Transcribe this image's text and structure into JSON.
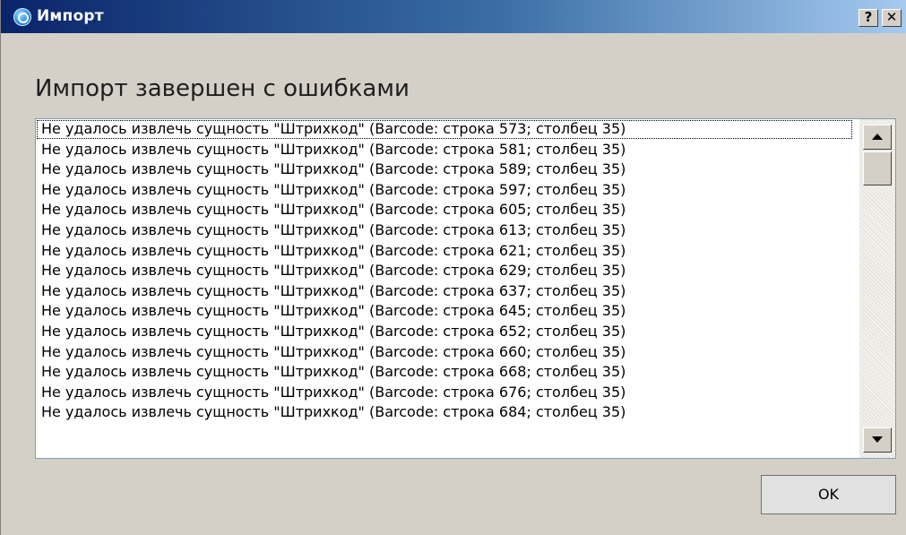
{
  "window": {
    "title": "Импорт",
    "help_label": "?",
    "close_label": "✕"
  },
  "heading": "Импорт завершен с ошибками",
  "errors": [
    "Не удалось извлечь сущность \"Штрихкод\" (Barcode: строка 573; столбец 35)",
    "Не удалось извлечь сущность \"Штрихкод\" (Barcode: строка 581; столбец 35)",
    "Не удалось извлечь сущность \"Штрихкод\" (Barcode: строка 589; столбец 35)",
    "Не удалось извлечь сущность \"Штрихкод\" (Barcode: строка 597; столбец 35)",
    "Не удалось извлечь сущность \"Штрихкод\" (Barcode: строка 605; столбец 35)",
    "Не удалось извлечь сущность \"Штрихкод\" (Barcode: строка 613; столбец 35)",
    "Не удалось извлечь сущность \"Штрихкод\" (Barcode: строка 621; столбец 35)",
    "Не удалось извлечь сущность \"Штрихкод\" (Barcode: строка 629; столбец 35)",
    "Не удалось извлечь сущность \"Штрихкод\" (Barcode: строка 637; столбец 35)",
    "Не удалось извлечь сущность \"Штрихкод\" (Barcode: строка 645; столбец 35)",
    "Не удалось извлечь сущность \"Штрихкод\" (Barcode: строка 652; столбец 35)",
    "Не удалось извлечь сущность \"Штрихкод\" (Barcode: строка 660; столбец 35)",
    "Не удалось извлечь сущность \"Штрихкод\" (Barcode: строка 668; столбец 35)",
    "Не удалось извлечь сущность \"Штрихкод\" (Barcode: строка 676; столбец 35)",
    "Не удалось извлечь сущность \"Штрихкод\" (Barcode: строка 684; столбец 35)"
  ],
  "ok_label": "OK",
  "icons": {
    "app": "app-icon",
    "scroll_up": "scroll-up-arrow-icon",
    "scroll_down": "scroll-down-arrow-icon"
  }
}
